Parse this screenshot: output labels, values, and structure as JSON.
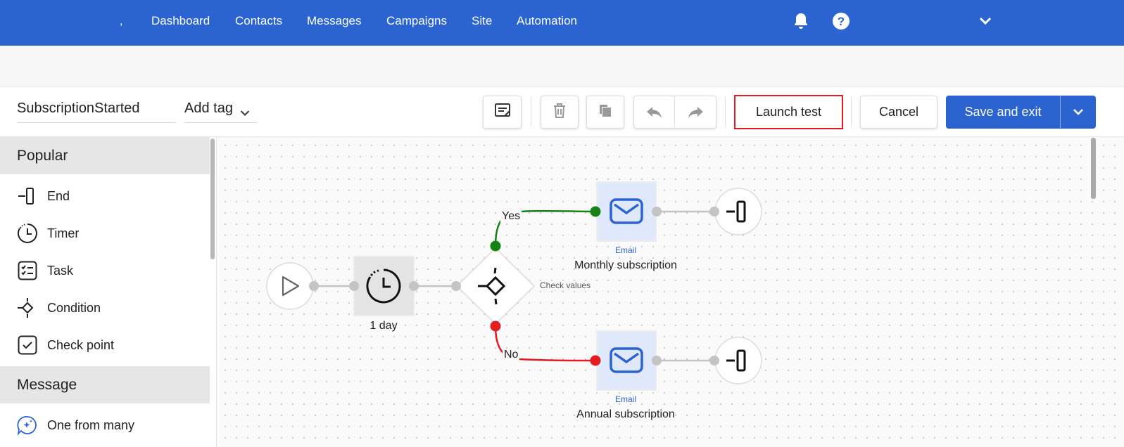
{
  "nav": {
    "comma": ",",
    "items": [
      "Dashboard",
      "Contacts",
      "Messages",
      "Campaigns",
      "Site",
      "Automation"
    ],
    "icons": [
      "bell-icon",
      "help-icon",
      "chevron-down-icon"
    ]
  },
  "toolbar": {
    "flow_name": "SubscriptionStarted",
    "tag_select": "Add tag",
    "launch_test": "Launch test",
    "cancel": "Cancel",
    "save_exit": "Save and exit"
  },
  "sidebar": {
    "sections": [
      {
        "title": "Popular",
        "items": [
          {
            "label": "End",
            "icon": "end-icon"
          },
          {
            "label": "Timer",
            "icon": "timer-icon"
          },
          {
            "label": "Task",
            "icon": "task-icon"
          },
          {
            "label": "Condition",
            "icon": "condition-icon"
          },
          {
            "label": "Check point",
            "icon": "checkpoint-icon"
          }
        ]
      },
      {
        "title": "Message",
        "items": [
          {
            "label": "One from many",
            "icon": "sparkle-chat-icon"
          }
        ]
      }
    ]
  },
  "flow": {
    "timer_label": "1 day",
    "condition_caption": "Check values",
    "yes_label": "Yes",
    "no_label": "No",
    "email_top": {
      "type": "Email",
      "name": "Monthly subscription"
    },
    "email_bottom": {
      "type": "Email",
      "name": "Annual subscription"
    },
    "colors": {
      "yes": "#168216",
      "no": "#e31b23",
      "accent": "#2b63d1"
    }
  }
}
